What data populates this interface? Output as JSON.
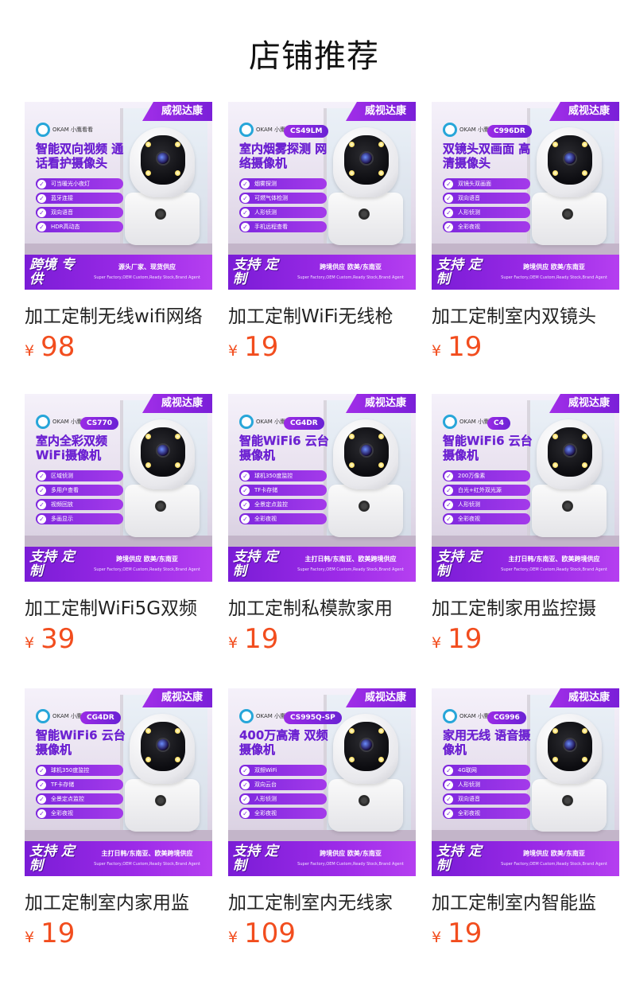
{
  "page": {
    "title": "店铺推荐"
  },
  "theme": {
    "price_color": "#f24d1e",
    "accent": "#7e27de"
  },
  "products": [
    {
      "brand": "威视达康",
      "logo_text": "OKAM 小鹰看看",
      "model": "",
      "headline": "智能双向视频 通话看护摄像头",
      "features": [
        "可当暖光小夜灯",
        "蓝牙连接",
        "双向语音",
        "HDR高动态"
      ],
      "promo_main": "跨境 专供",
      "promo_sub": "源头厂家、现货供应",
      "promo_en": "Super Factory,OEM Custom,Ready Stock,Brand Agent",
      "name": "加工定制无线wifi网络",
      "currency": "¥",
      "price": "98"
    },
    {
      "brand": "威视达康",
      "logo_text": "OKAM 小鹰看看",
      "model": "CS49LM",
      "headline": "室内烟雾探测 网络摄像机",
      "features": [
        "烟雾探测",
        "可燃气体检测",
        "人形侦测",
        "手机远程查看"
      ],
      "promo_main": "支持 定制",
      "promo_sub": "跨境供应 欧美/东南亚",
      "promo_en": "Super Factory,OEM Custom,Ready Stock,Brand Agent",
      "name": "加工定制WiFi无线枪",
      "currency": "¥",
      "price": "19"
    },
    {
      "brand": "威视达康",
      "logo_text": "OKAM 小鹰看看",
      "model": "C996DR",
      "headline": "双镜头双画面 高清摄像头",
      "features": [
        "双镜头双画面",
        "双向语音",
        "人形侦测",
        "全彩夜视"
      ],
      "promo_main": "支持 定制",
      "promo_sub": "跨境供应 欧美/东南亚",
      "promo_en": "Super Factory,OEM Custom,Ready Stock,Brand Agent",
      "name": "加工定制室内双镜头",
      "currency": "¥",
      "price": "19"
    },
    {
      "brand": "威视达康",
      "logo_text": "OKAM 小鹰看看",
      "model": "CS770",
      "headline": "室内全彩双频 WiFi摄像机",
      "features": [
        "区域侦测",
        "多用户查看",
        "视频回放",
        "多画显示"
      ],
      "promo_main": "支持 定制",
      "promo_sub": "跨境供应 欧美/东南亚",
      "promo_en": "Super Factory,OEM Custom,Ready Stock,Brand Agent",
      "name": "加工定制WiFi5G双频",
      "currency": "¥",
      "price": "39"
    },
    {
      "brand": "威视达康",
      "logo_text": "OKAM 小鹰看看",
      "model": "CG4DR",
      "headline": "智能WiFi6 云台摄像机",
      "features": [
        "球机350度监控",
        "TF卡存储",
        "全景定点监控",
        "全彩夜视"
      ],
      "promo_main": "支持 定制",
      "promo_sub": "主打日韩/东南亚、欧美跨境供应",
      "promo_en": "Super Factory,OEM Custom,Ready Stock,Brand Agent",
      "name": "加工定制私模款家用",
      "currency": "¥",
      "price": "19"
    },
    {
      "brand": "威视达康",
      "logo_text": "OKAM 小鹰看看",
      "model": "C4",
      "headline": "智能WiFi6 云台摄像机",
      "features": [
        "200万像素",
        "白光+红外双光源",
        "人形侦测",
        "全彩夜视"
      ],
      "promo_main": "支持 定制",
      "promo_sub": "主打日韩/东南亚、欧美跨境供应",
      "promo_en": "Super Factory,OEM Custom,Ready Stock,Brand Agent",
      "name": "加工定制家用监控摄",
      "currency": "¥",
      "price": "19"
    },
    {
      "brand": "威视达康",
      "logo_text": "OKAM 小鹰看看",
      "model": "CG4DR",
      "headline": "智能WiFi6 云台摄像机",
      "features": [
        "球机350度监控",
        "TF卡存储",
        "全景定点监控",
        "全彩夜视"
      ],
      "promo_main": "支持 定制",
      "promo_sub": "主打日韩/东南亚、欧美跨境供应",
      "promo_en": "Super Factory,OEM Custom,Ready Stock,Brand Agent",
      "name": "加工定制室内家用监",
      "currency": "¥",
      "price": "19"
    },
    {
      "brand": "威视达康",
      "logo_text": "OKAM 小鹰看看",
      "model": "CS995Q-SP",
      "headline": "400万高清 双频摄像机",
      "features": [
        "双频WiFi",
        "双向云台",
        "人形侦测",
        "全彩夜视"
      ],
      "promo_main": "支持 定制",
      "promo_sub": "跨境供应 欧美/东南亚",
      "promo_en": "Super Factory,OEM Custom,Ready Stock,Brand Agent",
      "name": "加工定制室内无线家",
      "currency": "¥",
      "price": "109"
    },
    {
      "brand": "威视达康",
      "logo_text": "OKAM 小鹰看看",
      "model": "CG996",
      "headline": "家用无线 语音摄像机",
      "features": [
        "4G联网",
        "人形侦测",
        "双向语音",
        "全彩夜视"
      ],
      "promo_main": "支持 定制",
      "promo_sub": "跨境供应 欧美/东南亚",
      "promo_en": "Super Factory,OEM Custom,Ready Stock,Brand Agent",
      "name": "加工定制室内智能监",
      "currency": "¥",
      "price": "19"
    }
  ]
}
